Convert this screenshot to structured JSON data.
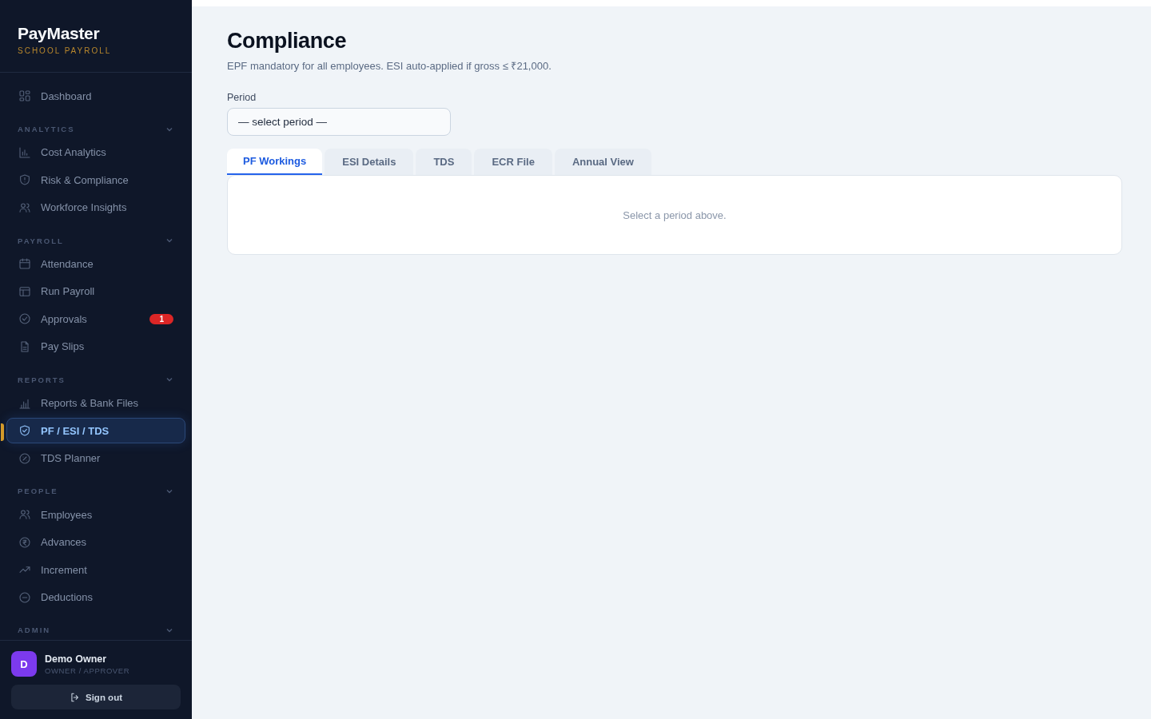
{
  "sidebar": {
    "brand": "PayMaster",
    "tagline": "SCHOOL PAYROLL",
    "sections": [
      {
        "items": [
          {
            "label": "Dashboard",
            "selected": false
          }
        ]
      },
      {
        "label": "ANALYTICS",
        "expanded": true,
        "items": [
          {
            "label": "Cost Analytics",
            "selected": false
          },
          {
            "label": "Risk & Compliance",
            "selected": false
          },
          {
            "label": "Workforce Insights",
            "selected": false
          }
        ]
      },
      {
        "label": "PAYROLL",
        "expanded": true,
        "items": [
          {
            "label": "Attendance",
            "selected": false
          },
          {
            "label": "Run Payroll",
            "selected": false
          },
          {
            "label": "Approvals",
            "selected": false,
            "badge": "1"
          },
          {
            "label": "Pay Slips",
            "selected": false
          }
        ]
      },
      {
        "label": "REPORTS",
        "expanded": true,
        "items": [
          {
            "label": "Reports & Bank Files",
            "selected": false
          },
          {
            "label": "PF / ESI / TDS",
            "selected": true
          },
          {
            "label": "TDS Planner",
            "selected": false
          }
        ]
      },
      {
        "label": "PEOPLE",
        "expanded": true,
        "items": [
          {
            "label": "Employees",
            "selected": false
          },
          {
            "label": "Advances",
            "selected": false
          },
          {
            "label": "Increment",
            "selected": false
          },
          {
            "label": "Deductions",
            "selected": false
          }
        ]
      },
      {
        "label": "ADMIN",
        "expanded": true
      }
    ],
    "user": {
      "initial": "D",
      "name": "Demo Owner",
      "role": "OWNER / APPROVER"
    },
    "sign_out": "Sign out"
  },
  "page": {
    "title": "Compliance",
    "subtitle": "EPF mandatory for all employees. ESI auto-applied if gross ≤ ₹21,000.",
    "period": {
      "label": "Period",
      "value": "— select period —"
    },
    "tabs": [
      {
        "label": "PF Workings",
        "selected": true
      },
      {
        "label": "ESI Details",
        "selected": false
      },
      {
        "label": "TDS",
        "selected": false
      },
      {
        "label": "ECR File",
        "selected": false
      },
      {
        "label": "Annual View",
        "selected": false
      }
    ],
    "empty_message": "Select a period above."
  }
}
